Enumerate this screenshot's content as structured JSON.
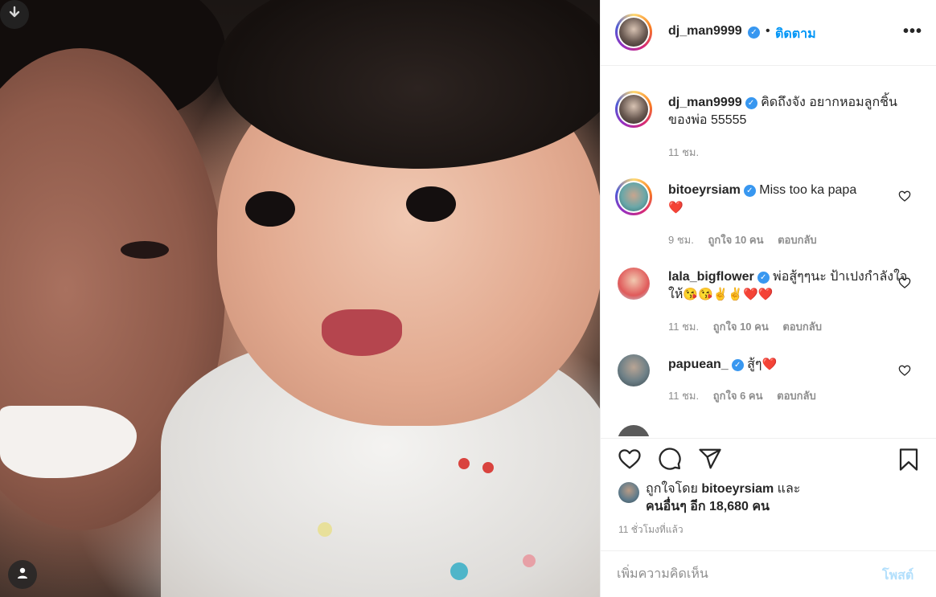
{
  "header": {
    "username": "dj_man9999",
    "separator": "•",
    "follow_label": "ติดตาม",
    "more_label": "•••"
  },
  "caption": {
    "username": "dj_man9999",
    "text": "คิดถึงจัง อยากหอมลูกชิ้นของพ่อ 55555",
    "time": "11 ชม."
  },
  "comments": [
    {
      "username": "bitoeyrsiam",
      "text": "Miss too ka papa",
      "emoji": "❤️",
      "time": "9 ชม.",
      "likes": "ถูกใจ 10 คน",
      "reply": "ตอบกลับ"
    },
    {
      "username": "lala_bigflower",
      "text": "พ่อสู้ๆๆนะ ป้าเปงกำลังใจให้",
      "emoji": "😘😘✌️✌️❤️❤️",
      "time": "11 ชม.",
      "likes": "ถูกใจ 10 คน",
      "reply": "ตอบกลับ"
    },
    {
      "username": "papuean_",
      "text": "สู้ๆ",
      "emoji": "❤️",
      "time": "11 ชม.",
      "likes": "ถูกใจ 6 คน",
      "reply": "ตอบกลับ"
    }
  ],
  "likes": {
    "prefix": "ถูกใจโดย",
    "first_user": "bitoeyrsiam",
    "and": "และ",
    "others": "คนอื่นๆ อีก 18,680 คน",
    "time_ago": "11 ชั่วโมงที่แล้ว"
  },
  "add_comment": {
    "placeholder": "เพิ่มความคิดเห็น",
    "post_label": "โพสต์"
  },
  "icons": {
    "download": "download-icon",
    "user": "user-icon",
    "like": "heart-icon",
    "comment": "comment-icon",
    "share": "share-icon",
    "save": "bookmark-icon",
    "verified": "verified-icon"
  },
  "colors": {
    "link_blue": "#0095f6",
    "verified_blue": "#3897f0",
    "muted": "#8e8e8e",
    "post_disabled": "#b2dffc",
    "heart_red": "#ed4956"
  }
}
